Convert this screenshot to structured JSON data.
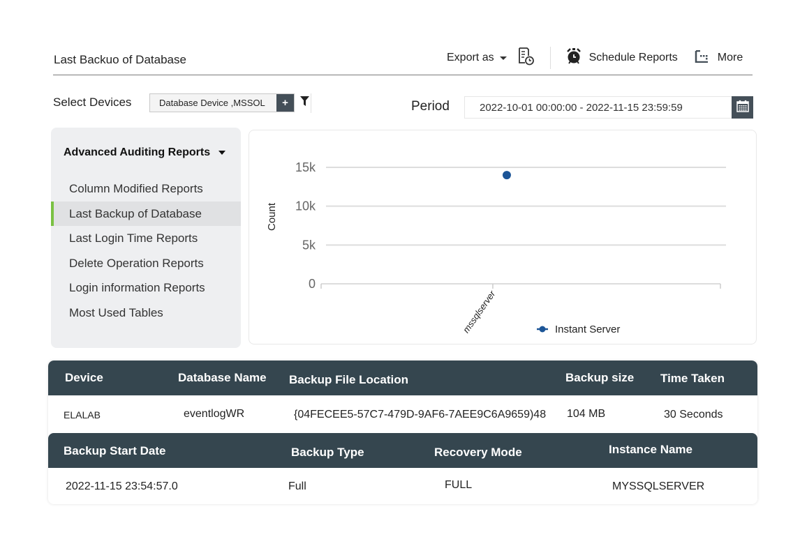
{
  "header": {
    "title": "Last Backuo of Database",
    "export_label": "Export as",
    "schedule_label": "Schedule Reports",
    "more_label": "More"
  },
  "filters": {
    "select_devices_label": "Select Devices",
    "selected_devices": "Database Device ,MSSOL",
    "add_button": "+",
    "period_label": "Period",
    "period_value": "2022-10-01 00:00:00 - 2022-11-15 23:59:59"
  },
  "sidebar": {
    "heading": "Advanced Auditing Reports",
    "items": [
      {
        "label": "Column Modified Reports",
        "active": false
      },
      {
        "label": "Last Backup of Database",
        "active": true
      },
      {
        "label": "Last Login Time Reports",
        "active": false
      },
      {
        "label": "Delete Operation Reports",
        "active": false
      },
      {
        "label": "Login information Reports",
        "active": false
      },
      {
        "label": "Most Used Tables",
        "active": false
      }
    ]
  },
  "chart_data": {
    "type": "scatter",
    "title": "",
    "xlabel": "",
    "ylabel": "Count",
    "categories": [
      "mssqlserver"
    ],
    "series": [
      {
        "name": "Instant Server",
        "color": "#1c5597",
        "values": [
          14000
        ]
      }
    ],
    "ylim": [
      0,
      15000
    ],
    "yticks": [
      0,
      5000,
      10000,
      15000
    ],
    "ytick_labels": [
      "0",
      "5k",
      "10k",
      "15k"
    ],
    "grid": true,
    "legend": "bottom-center"
  },
  "table1": {
    "columns": [
      "Device",
      "Database Name",
      "Backup File Location",
      "Backup size",
      "Time Taken"
    ],
    "rows": [
      [
        "ELALAB",
        "eventlogWR",
        "{04FECEE5-57C7-479D-9AF6-7AEE9C6A9659)48",
        "104 MB",
        "30 Seconds"
      ]
    ]
  },
  "table2": {
    "columns": [
      "Backup Start Date",
      "Backup Type",
      "Recovery Mode",
      "Instance Name"
    ],
    "rows": [
      [
        "2022-11-15 23:54:57.0",
        "Full",
        "FULL",
        "MYSSQLSERVER"
      ]
    ]
  },
  "colors": {
    "header_bg": "#35464f",
    "accent_active": "#7ac143",
    "series": "#1c5597",
    "button_dark": "#444f58"
  }
}
